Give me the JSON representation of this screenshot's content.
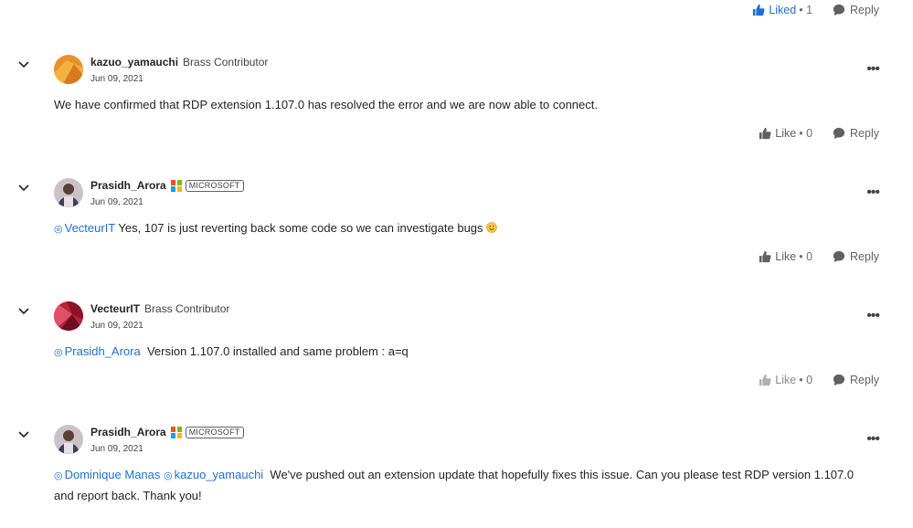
{
  "top": {
    "like_label": "Liked",
    "like_count": "1",
    "reply_label": "Reply"
  },
  "comments": [
    {
      "author": "kazuo_yamauchi",
      "rank": "Brass Contributor",
      "date": "Jun 09, 2021",
      "text": "We have confirmed that RDP extension 1.107.0 has resolved the error and we are now able to connect.",
      "like_label": "Like",
      "like_count": "0",
      "reply_label": "Reply"
    },
    {
      "author": "Prasidh_Arora",
      "badge": "MICROSOFT",
      "date": "Jun 09, 2021",
      "mention": "VecteurIT",
      "text": "Yes, 107 is just reverting back some code so we can investigate bugs",
      "like_label": "Like",
      "like_count": "0",
      "reply_label": "Reply"
    },
    {
      "author": "VecteurIT",
      "rank": "Brass Contributor",
      "date": "Jun 09, 2021",
      "mention": "Prasidh_Arora",
      "text": "Version 1.107.0 installed and same problem : a=q",
      "like_label": "Like",
      "like_count": "0",
      "reply_label": "Reply"
    },
    {
      "author": "Prasidh_Arora",
      "badge": "MICROSOFT",
      "date": "Jun 09, 2021",
      "mention1": "Dominique Manas",
      "mention2": "kazuo_yamauchi",
      "text": "We've pushed out an extension update that hopefully fixes this issue. Can you please test RDP version 1.107.0 and report back. Thank you!"
    }
  ],
  "icons": {
    "chevron": "chevron-down-icon",
    "thumb": "thumbs-up-icon",
    "reply": "reply-bubble-icon",
    "more": "more-options-icon",
    "mention": "at-mention-icon",
    "emoji": "slightly-smiling-emoji"
  },
  "colors": {
    "link": "#1f6fd1",
    "text": "#242424",
    "icon": "#616161"
  }
}
